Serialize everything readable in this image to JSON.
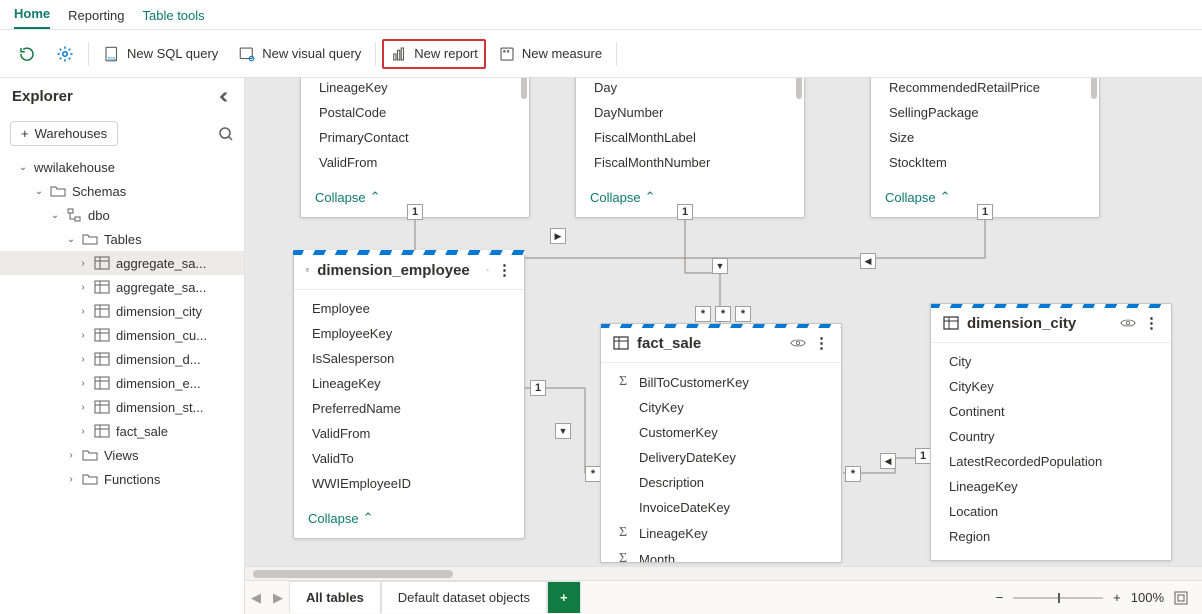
{
  "tabs": {
    "home": "Home",
    "reporting": "Reporting",
    "table_tools": "Table tools"
  },
  "toolbar": {
    "new_sql": "New SQL query",
    "new_visual": "New visual query",
    "new_report": "New report",
    "new_measure": "New measure"
  },
  "explorer": {
    "title": "Explorer",
    "add_wh": "Warehouses",
    "root": "wwilakehouse",
    "schemas": "Schemas",
    "dbo": "dbo",
    "tables": "Tables",
    "views": "Views",
    "functions": "Functions",
    "items": [
      "aggregate_sa...",
      "aggregate_sa...",
      "dimension_city",
      "dimension_cu...",
      "dimension_d...",
      "dimension_e...",
      "dimension_st...",
      "fact_sale"
    ]
  },
  "canvas": {
    "collapse": "Collapse",
    "cardA": {
      "fields": [
        "LineageKey",
        "PostalCode",
        "PrimaryContact",
        "ValidFrom"
      ]
    },
    "cardB": {
      "fields": [
        "Day",
        "DayNumber",
        "FiscalMonthLabel",
        "FiscalMonthNumber"
      ]
    },
    "cardC": {
      "fields": [
        "RecommendedRetailPrice",
        "SellingPackage",
        "Size",
        "StockItem"
      ]
    },
    "emp": {
      "title": "dimension_employee",
      "fields": [
        "Employee",
        "EmployeeKey",
        "IsSalesperson",
        "LineageKey",
        "PreferredName",
        "ValidFrom",
        "ValidTo",
        "WWIEmployeeID"
      ]
    },
    "fact": {
      "title": "fact_sale",
      "fields": [
        {
          "t": "BillToCustomerKey",
          "s": true
        },
        {
          "t": "CityKey"
        },
        {
          "t": "CustomerKey"
        },
        {
          "t": "DeliveryDateKey"
        },
        {
          "t": "Description"
        },
        {
          "t": "InvoiceDateKey"
        },
        {
          "t": "LineageKey",
          "s": true
        },
        {
          "t": "Month",
          "s": true
        }
      ]
    },
    "city": {
      "title": "dimension_city",
      "fields": [
        "City",
        "CityKey",
        "Continent",
        "Country",
        "LatestRecordedPopulation",
        "LineageKey",
        "Location",
        "Region"
      ]
    }
  },
  "bottom": {
    "all_tables": "All tables",
    "default_ds": "Default dataset objects",
    "plus": "+",
    "zoom": "100%"
  }
}
